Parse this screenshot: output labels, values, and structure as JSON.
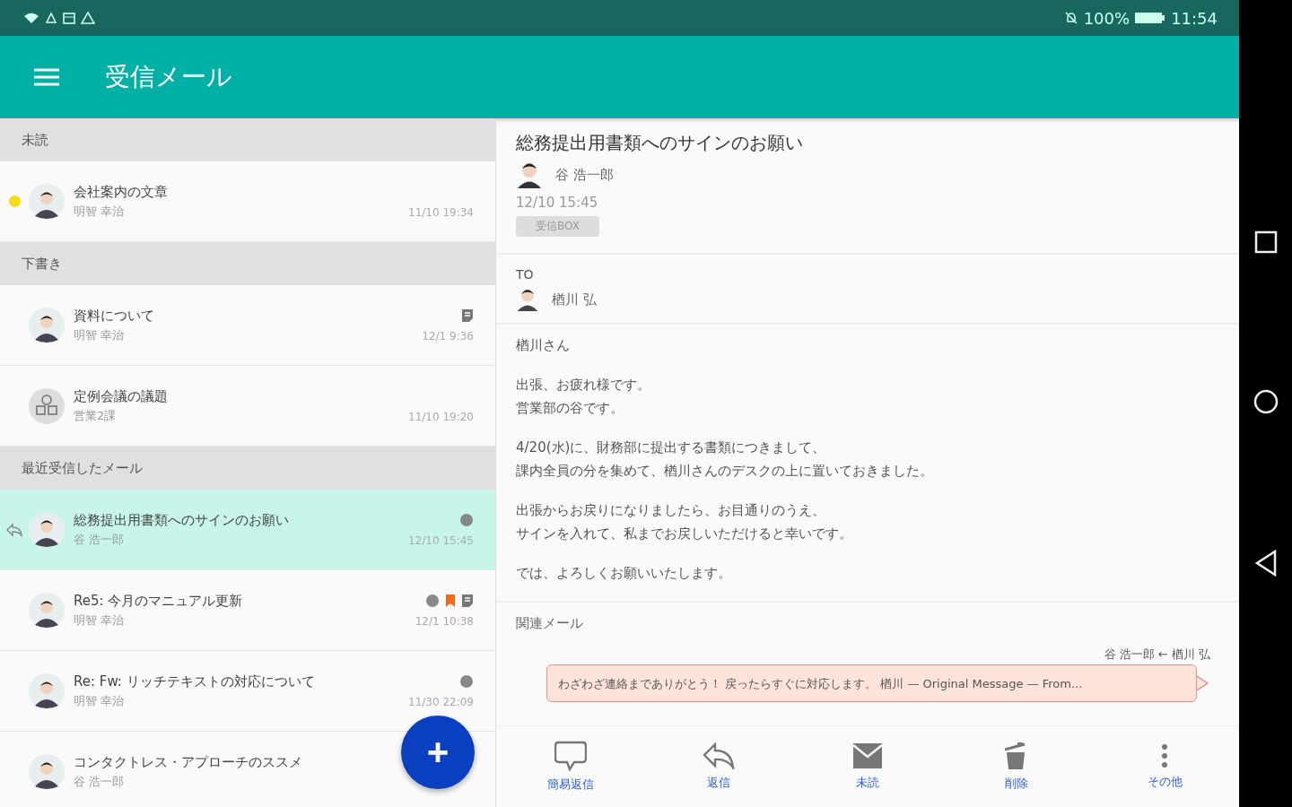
{
  "status_bar": {
    "battery": "100%",
    "time": "11:54"
  },
  "app_bar": {
    "title": "受信メール"
  },
  "sections": [
    {
      "title": "未読",
      "items": [
        {
          "subject": "会社案内の文章",
          "sender": "明智 幸治",
          "date": "11/10 19:34",
          "avatar": {
            "kind": "person"
          },
          "unread": true,
          "replied": false,
          "selected": false
        }
      ]
    },
    {
      "title": "下書き",
      "items": [
        {
          "subject": "資料について",
          "sender": "明智 幸治",
          "date": "12/1 9:36",
          "avatar": {
            "kind": "person"
          },
          "unread": false,
          "replied": false,
          "selected": false,
          "icons": [
            {
              "kind": "memo"
            }
          ]
        },
        {
          "subject": "定例会議の議題",
          "sender": "営業2課",
          "date": "11/10 19:20",
          "avatar": {
            "kind": "group"
          },
          "unread": false,
          "replied": false,
          "selected": false
        }
      ]
    },
    {
      "title": "最近受信したメール",
      "items": [
        {
          "subject": "総務提出用書類へのサインのお願い",
          "sender": "谷 浩一郎",
          "date": "12/10 15:45",
          "avatar": {
            "kind": "person"
          },
          "unread": false,
          "replied": true,
          "selected": true,
          "icons": [
            {
              "kind": "label"
            }
          ]
        },
        {
          "subject": "Re5: 今月のマニュアル更新",
          "sender": "明智 幸治",
          "date": "12/1 10:38",
          "avatar": {
            "kind": "person"
          },
          "unread": false,
          "replied": false,
          "selected": false,
          "icons": [
            {
              "kind": "label"
            },
            {
              "kind": "bookmark"
            },
            {
              "kind": "memo"
            }
          ]
        },
        {
          "subject": "Re: Fw: リッチテキストの対応について",
          "sender": "明智 幸治",
          "date": "11/30 22:09",
          "avatar": {
            "kind": "person"
          },
          "unread": false,
          "replied": false,
          "selected": false,
          "icons": [
            {
              "kind": "label"
            }
          ]
        },
        {
          "subject": "コンタクトレス・アプローチのススメ",
          "sender": "谷 浩一郎",
          "avatar": {
            "kind": "person"
          },
          "unread": false,
          "replied": false,
          "selected": false
        }
      ]
    }
  ],
  "fab": {
    "label": "+"
  },
  "message": {
    "subject": "総務提出用書類へのサインのお願い",
    "sender": "谷 浩一郎",
    "date": "12/10 15:45",
    "folder": "受信BOX",
    "to_label": "TO",
    "recipients": [
      "楢川 弘"
    ],
    "body": [
      [
        "楢川さん"
      ],
      [
        "出張、お疲れ様です。",
        "営業部の谷です。"
      ],
      [
        "4/20(水)に、財務部に提出する書類につきまして、",
        "課内全員の分を集めて、楢川さんのデスクの上に置いておきました。"
      ],
      [
        "出張からお戻りになりましたら、お目通りのうえ、",
        "サインを入れて、私までお戻しいただけると幸いです。"
      ],
      [
        "では、よろしくお願いいたします。"
      ]
    ],
    "related_label": "関連メール",
    "related": [
      {
        "route": "谷 浩一郎 ← 楢川 弘",
        "preview": "わざわざ連絡までありがとう！ 戻ったらすぐに対応します。 楢川 — Original Message — From..."
      }
    ]
  },
  "toolbar": [
    {
      "kind": "quick-reply",
      "label": "簡易返信"
    },
    {
      "kind": "reply",
      "label": "返信"
    },
    {
      "kind": "unread",
      "label": "未読"
    },
    {
      "kind": "delete",
      "label": "削除"
    },
    {
      "kind": "more",
      "label": "その他"
    }
  ]
}
